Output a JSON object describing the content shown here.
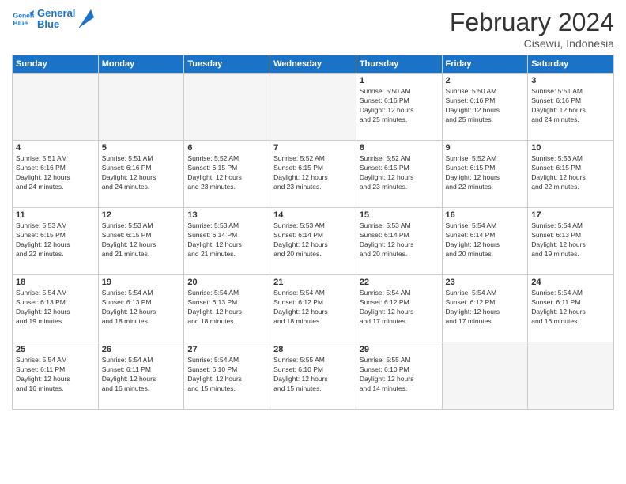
{
  "header": {
    "logo_line1": "General",
    "logo_line2": "Blue",
    "month": "February 2024",
    "location": "Cisewu, Indonesia"
  },
  "days_of_week": [
    "Sunday",
    "Monday",
    "Tuesday",
    "Wednesday",
    "Thursday",
    "Friday",
    "Saturday"
  ],
  "weeks": [
    [
      {
        "num": "",
        "info": ""
      },
      {
        "num": "",
        "info": ""
      },
      {
        "num": "",
        "info": ""
      },
      {
        "num": "",
        "info": ""
      },
      {
        "num": "1",
        "info": "Sunrise: 5:50 AM\nSunset: 6:16 PM\nDaylight: 12 hours\nand 25 minutes."
      },
      {
        "num": "2",
        "info": "Sunrise: 5:50 AM\nSunset: 6:16 PM\nDaylight: 12 hours\nand 25 minutes."
      },
      {
        "num": "3",
        "info": "Sunrise: 5:51 AM\nSunset: 6:16 PM\nDaylight: 12 hours\nand 24 minutes."
      }
    ],
    [
      {
        "num": "4",
        "info": "Sunrise: 5:51 AM\nSunset: 6:16 PM\nDaylight: 12 hours\nand 24 minutes."
      },
      {
        "num": "5",
        "info": "Sunrise: 5:51 AM\nSunset: 6:16 PM\nDaylight: 12 hours\nand 24 minutes."
      },
      {
        "num": "6",
        "info": "Sunrise: 5:52 AM\nSunset: 6:15 PM\nDaylight: 12 hours\nand 23 minutes."
      },
      {
        "num": "7",
        "info": "Sunrise: 5:52 AM\nSunset: 6:15 PM\nDaylight: 12 hours\nand 23 minutes."
      },
      {
        "num": "8",
        "info": "Sunrise: 5:52 AM\nSunset: 6:15 PM\nDaylight: 12 hours\nand 23 minutes."
      },
      {
        "num": "9",
        "info": "Sunrise: 5:52 AM\nSunset: 6:15 PM\nDaylight: 12 hours\nand 22 minutes."
      },
      {
        "num": "10",
        "info": "Sunrise: 5:53 AM\nSunset: 6:15 PM\nDaylight: 12 hours\nand 22 minutes."
      }
    ],
    [
      {
        "num": "11",
        "info": "Sunrise: 5:53 AM\nSunset: 6:15 PM\nDaylight: 12 hours\nand 22 minutes."
      },
      {
        "num": "12",
        "info": "Sunrise: 5:53 AM\nSunset: 6:15 PM\nDaylight: 12 hours\nand 21 minutes."
      },
      {
        "num": "13",
        "info": "Sunrise: 5:53 AM\nSunset: 6:14 PM\nDaylight: 12 hours\nand 21 minutes."
      },
      {
        "num": "14",
        "info": "Sunrise: 5:53 AM\nSunset: 6:14 PM\nDaylight: 12 hours\nand 20 minutes."
      },
      {
        "num": "15",
        "info": "Sunrise: 5:53 AM\nSunset: 6:14 PM\nDaylight: 12 hours\nand 20 minutes."
      },
      {
        "num": "16",
        "info": "Sunrise: 5:54 AM\nSunset: 6:14 PM\nDaylight: 12 hours\nand 20 minutes."
      },
      {
        "num": "17",
        "info": "Sunrise: 5:54 AM\nSunset: 6:13 PM\nDaylight: 12 hours\nand 19 minutes."
      }
    ],
    [
      {
        "num": "18",
        "info": "Sunrise: 5:54 AM\nSunset: 6:13 PM\nDaylight: 12 hours\nand 19 minutes."
      },
      {
        "num": "19",
        "info": "Sunrise: 5:54 AM\nSunset: 6:13 PM\nDaylight: 12 hours\nand 18 minutes."
      },
      {
        "num": "20",
        "info": "Sunrise: 5:54 AM\nSunset: 6:13 PM\nDaylight: 12 hours\nand 18 minutes."
      },
      {
        "num": "21",
        "info": "Sunrise: 5:54 AM\nSunset: 6:12 PM\nDaylight: 12 hours\nand 18 minutes."
      },
      {
        "num": "22",
        "info": "Sunrise: 5:54 AM\nSunset: 6:12 PM\nDaylight: 12 hours\nand 17 minutes."
      },
      {
        "num": "23",
        "info": "Sunrise: 5:54 AM\nSunset: 6:12 PM\nDaylight: 12 hours\nand 17 minutes."
      },
      {
        "num": "24",
        "info": "Sunrise: 5:54 AM\nSunset: 6:11 PM\nDaylight: 12 hours\nand 16 minutes."
      }
    ],
    [
      {
        "num": "25",
        "info": "Sunrise: 5:54 AM\nSunset: 6:11 PM\nDaylight: 12 hours\nand 16 minutes."
      },
      {
        "num": "26",
        "info": "Sunrise: 5:54 AM\nSunset: 6:11 PM\nDaylight: 12 hours\nand 16 minutes."
      },
      {
        "num": "27",
        "info": "Sunrise: 5:54 AM\nSunset: 6:10 PM\nDaylight: 12 hours\nand 15 minutes."
      },
      {
        "num": "28",
        "info": "Sunrise: 5:55 AM\nSunset: 6:10 PM\nDaylight: 12 hours\nand 15 minutes."
      },
      {
        "num": "29",
        "info": "Sunrise: 5:55 AM\nSunset: 6:10 PM\nDaylight: 12 hours\nand 14 minutes."
      },
      {
        "num": "",
        "info": ""
      },
      {
        "num": "",
        "info": ""
      }
    ]
  ]
}
